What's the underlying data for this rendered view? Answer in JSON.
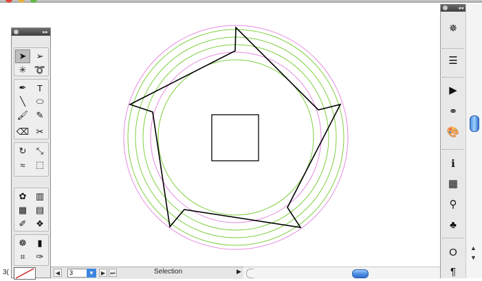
{
  "window": {
    "title": ""
  },
  "colors": {
    "guide_pink": "#e58adf",
    "guide_green": "#7fcf3f",
    "path_stroke": "#000000",
    "accent_blue": "#3d86e0"
  },
  "tools_panel": {
    "tools": [
      {
        "name": "selection-tool-icon",
        "glyph": "➤"
      },
      {
        "name": "direct-selection-tool-icon",
        "glyph": "➢"
      },
      {
        "name": "magic-wand-tool-icon",
        "glyph": "✳"
      },
      {
        "name": "lasso-tool-icon",
        "glyph": "➰"
      },
      {
        "name": "pen-tool-icon",
        "glyph": "✒"
      },
      {
        "name": "type-tool-icon",
        "glyph": "T"
      },
      {
        "name": "line-tool-icon",
        "glyph": "╲"
      },
      {
        "name": "ellipse-tool-icon",
        "glyph": "⬭"
      },
      {
        "name": "paintbrush-tool-icon",
        "glyph": "🖌"
      },
      {
        "name": "pencil-tool-icon",
        "glyph": "✎"
      },
      {
        "name": "eraser-tool-icon",
        "glyph": "⌫"
      },
      {
        "name": "scissors-tool-icon",
        "glyph": "✂"
      },
      {
        "name": "rotate-tool-icon",
        "glyph": "↻"
      },
      {
        "name": "scale-tool-icon",
        "glyph": "⤡"
      },
      {
        "name": "warp-tool-icon",
        "glyph": "≈"
      },
      {
        "name": "free-transform-tool-icon",
        "glyph": "⬚"
      },
      {
        "name": "symbol-sprayer-tool-icon",
        "glyph": "✿"
      },
      {
        "name": "column-graph-tool-icon",
        "glyph": "▥"
      },
      {
        "name": "mesh-tool-icon",
        "glyph": "▦"
      },
      {
        "name": "gradient-tool-icon",
        "glyph": "▤"
      },
      {
        "name": "eyedropper-tool-icon",
        "glyph": "✐"
      },
      {
        "name": "blend-tool-icon",
        "glyph": "❖"
      },
      {
        "name": "symbol-tool-icon",
        "glyph": "☸"
      },
      {
        "name": "graph-tool-icon",
        "glyph": "▮"
      },
      {
        "name": "artboard-tool-icon",
        "glyph": "⌗"
      },
      {
        "name": "slice-tool-icon",
        "glyph": "✑"
      },
      {
        "name": "hand-tool-icon",
        "glyph": "✋"
      },
      {
        "name": "zoom-tool-icon",
        "glyph": "🔍"
      }
    ]
  },
  "dock": {
    "buttons": [
      {
        "name": "navigator-icon",
        "glyph": "✵"
      },
      {
        "name": "stroke-icon",
        "glyph": "☰"
      },
      {
        "name": "actions-icon",
        "glyph": "▶"
      },
      {
        "name": "links-icon",
        "glyph": "⚭"
      },
      {
        "name": "color-icon",
        "glyph": "🎨"
      },
      {
        "name": "info-icon",
        "glyph": "ℹ"
      },
      {
        "name": "swatches-icon",
        "glyph": "▦"
      },
      {
        "name": "brushes-icon",
        "glyph": "⚲"
      },
      {
        "name": "symbols-icon",
        "glyph": "♣"
      },
      {
        "name": "character-icon",
        "glyph": "O"
      },
      {
        "name": "paragraph-icon",
        "glyph": "¶"
      }
    ]
  },
  "statusbar": {
    "zoom_text": "3(",
    "page_value": "3",
    "status_label": "Selection"
  }
}
